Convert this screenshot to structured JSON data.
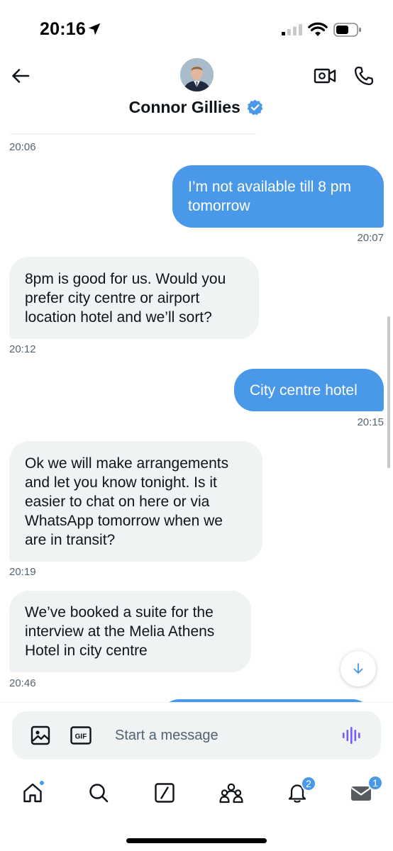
{
  "status_bar": {
    "time": "20:16"
  },
  "header": {
    "contact_name": "Connor Gillies"
  },
  "messages": [
    {
      "direction": "in",
      "text": "",
      "time": "20:06"
    },
    {
      "direction": "out",
      "lines": [
        "I’m not available till 8 pm",
        "tomorrow"
      ],
      "time": "20:07"
    },
    {
      "direction": "in",
      "lines": [
        "8pm is good for us. Would you",
        "prefer city centre or airport",
        "location hotel and we’ll sort?"
      ],
      "time": "20:12"
    },
    {
      "direction": "out",
      "lines": [
        "City centre hotel"
      ],
      "time": "20:15"
    },
    {
      "direction": "in",
      "lines": [
        "Ok we will make arrangements",
        "and let you know tonight. Is it",
        "easier to chat on here or via",
        "WhatsApp tomorrow when we",
        "are in transit?"
      ],
      "time": "20:19"
    },
    {
      "direction": "in",
      "lines": [
        "We’ve booked a suite for the",
        "interview at the Melia Athens",
        "Hotel in city centre"
      ],
      "time": "20:46"
    }
  ],
  "composer": {
    "placeholder": "Start a message",
    "gif_label": "GIF"
  },
  "nav": {
    "notifications_badge": "2",
    "messages_badge": "1"
  },
  "colors": {
    "accent": "#4a99e9",
    "incoming_bubble": "#eff3f4",
    "text": "#0f1419",
    "muted": "#536471"
  }
}
